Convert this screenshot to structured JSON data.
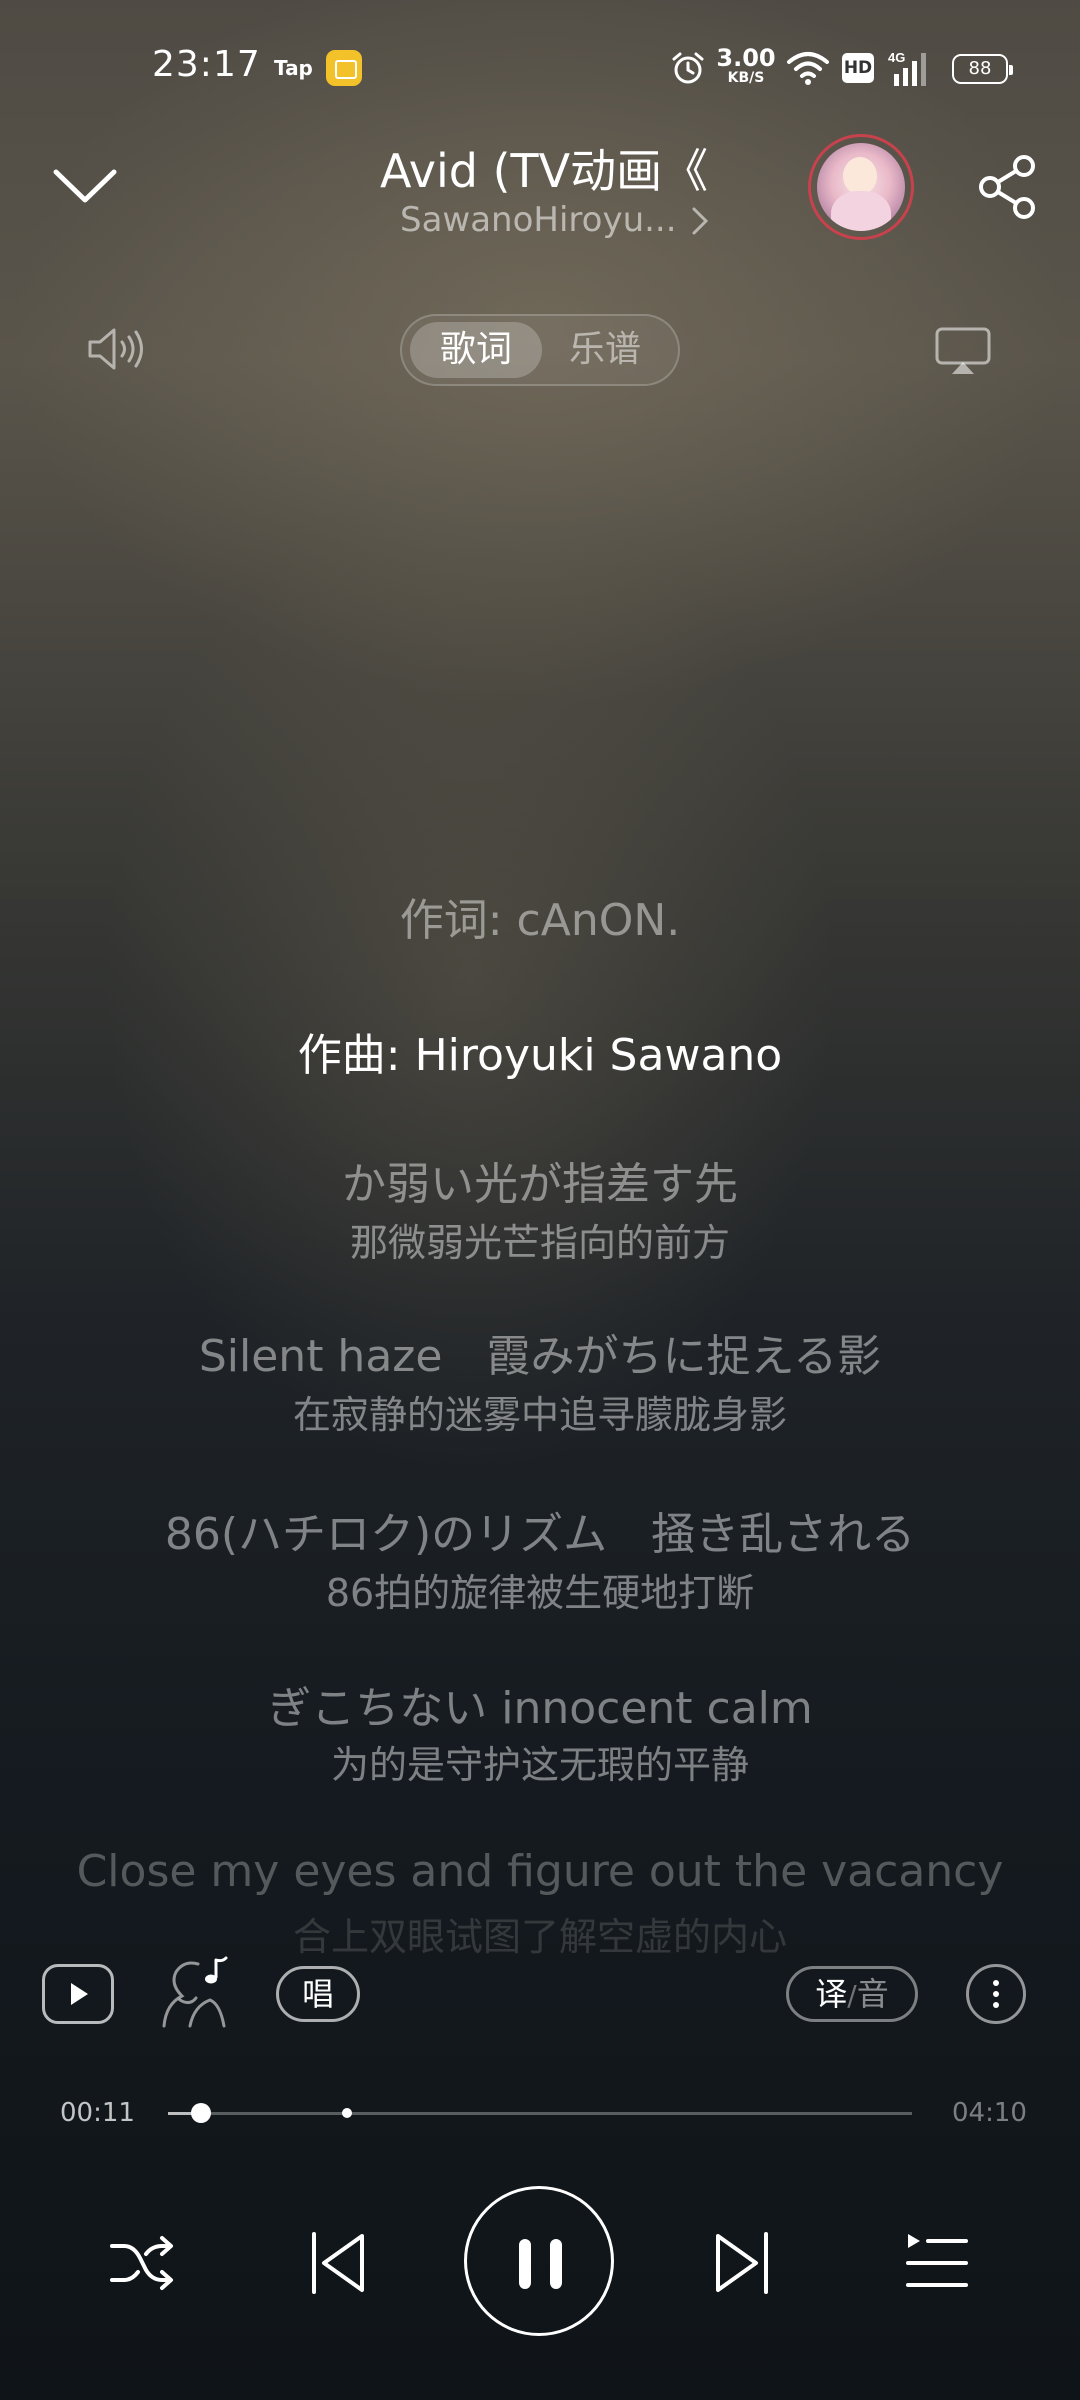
{
  "status_bar": {
    "time": "23:17",
    "tap_label": "Tap",
    "net_speed_value": "3.00",
    "net_speed_unit": "KB/S",
    "hd_label": "HD",
    "network_type": "4G",
    "battery": "88"
  },
  "header": {
    "title": "Avid (TV动画《",
    "artist": "SawanoHiroyu..."
  },
  "tabs": {
    "lyrics": "歌词",
    "score": "乐谱",
    "active": "lyrics"
  },
  "lyrics": [
    {
      "original": "作词: cAnON.",
      "translation": ""
    },
    {
      "original": "作曲: Hiroyuki Sawano",
      "translation": "",
      "active": true
    },
    {
      "original": "か弱い光が指差す先",
      "translation": "那微弱光芒指向的前方"
    },
    {
      "original": "Silent haze　霞みがちに捉える影",
      "translation": "在寂静的迷雾中追寻朦胧身影"
    },
    {
      "original": "86(ハチロク)のリズム　掻き乱される",
      "translation": "86拍的旋律被生硬地打断"
    },
    {
      "original": "ぎこちない innocent calm",
      "translation": "为的是守护这无瑕的平静"
    },
    {
      "original": "Close my eyes and figure out the vacancy",
      "translation": "合上双眼试图了解空虚的内心"
    }
  ],
  "tools": {
    "sing_label": "唱",
    "translate_on": "译",
    "translate_separator": "/",
    "translate_off": "音"
  },
  "progress": {
    "elapsed": "00:11",
    "total": "04:10",
    "played_fraction": 0.044,
    "buffered_fraction": 0.24
  },
  "icons": {
    "collapse": "chevron-down-icon",
    "share": "share-icon",
    "volume": "volume-icon",
    "cast": "cast-icon",
    "shuffle": "shuffle-icon",
    "previous": "skip-previous-icon",
    "pause": "pause-icon",
    "next": "skip-next-icon",
    "queue": "queue-icon"
  },
  "colors": {
    "avatar_ring": "#c7424d",
    "tap_app": "#f3c22a"
  }
}
